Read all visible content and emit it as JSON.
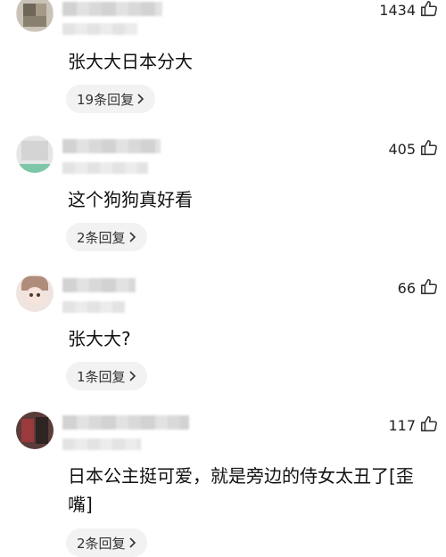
{
  "comments": [
    {
      "likes": "1434",
      "text": "张大大日本分大",
      "replies_label": "19条回复"
    },
    {
      "likes": "405",
      "text": "这个狗狗真好看",
      "replies_label": "2条回复"
    },
    {
      "likes": "66",
      "text": "张大大?",
      "replies_label": "1条回复"
    },
    {
      "likes": "117",
      "text": "日本公主挺可爱，就是旁边的侍女太丑了[歪嘴]",
      "replies_label": "2条回复"
    }
  ],
  "icons": {
    "like": "thumbs-up-icon",
    "replies": "chevron-right-icon"
  }
}
